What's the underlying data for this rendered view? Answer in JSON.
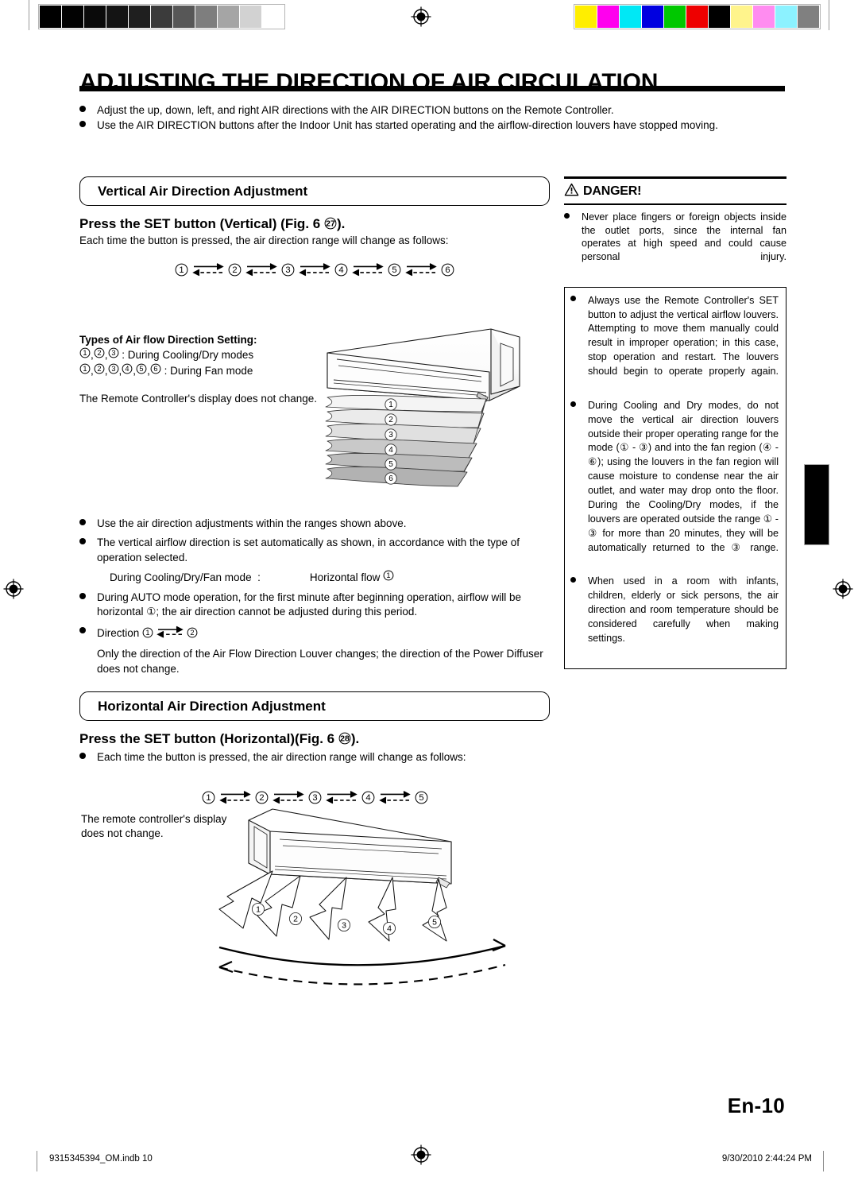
{
  "document": {
    "title": "ADJUSTING THE DIRECTION OF AIR CIRCULATION",
    "page_label": "En-10"
  },
  "intro": {
    "bullets": [
      "Adjust the up, down, left, and right AIR directions with the AIR DIRECTION buttons on the Remote Controller.",
      "Use the AIR DIRECTION buttons after the Indoor Unit has started operating and the airflow-direction louvers have stopped moving."
    ]
  },
  "vertical_section": {
    "heading": "Vertical Air Direction Adjustment",
    "subheading_pre": "Press the SET button (Vertical) (Fig. 6 ",
    "subheading_ref": "27",
    "subheading_post": ").",
    "lead": "Each time the button is pressed, the air direction range will change as follows:",
    "cycle_numbers": [
      "1",
      "2",
      "3",
      "4",
      "5",
      "6"
    ],
    "types_title": "Types of Air flow Direction Setting:",
    "types_rows": [
      {
        "numbers": [
          "1",
          "2",
          "3"
        ],
        "separator": ":",
        "label": "During Cooling/Dry modes"
      },
      {
        "numbers": [
          "1",
          "2",
          "3",
          "4",
          "5",
          "6"
        ],
        "separator": ":",
        "label": "During Fan mode"
      }
    ],
    "remote_note": "The Remote Controller's display does not change.",
    "illustration_labels": [
      "1",
      "2",
      "3",
      "4",
      "5",
      "6"
    ],
    "bullets": [
      "Use the air direction adjustments within the ranges shown above.",
      "The vertical airflow direction is set automatically as shown, in accordance with the type of operation selected.",
      "During AUTO mode operation, for the first minute after beginning operation, airflow will be horizontal ①; the air direction cannot be adjusted during this period."
    ],
    "mode_row": {
      "mode": "During Cooling/Dry/Fan mode",
      "separator": ":",
      "value": "Horizontal flow",
      "value_number": "1"
    },
    "direction_row": {
      "label": "Direction",
      "from": "1",
      "to": "2"
    },
    "direction_note": "Only the direction of the Air Flow Direction Louver changes; the direction of the Power Diffuser does not change."
  },
  "horizontal_section": {
    "heading": "Horizontal Air Direction Adjustment",
    "subheading_pre": "Press the SET button (Horizontal)(Fig. 6 ",
    "subheading_ref": "28",
    "subheading_post": ").",
    "lead": "Each time the button is pressed, the air direction range will change as follows:",
    "cycle_numbers": [
      "1",
      "2",
      "3",
      "4",
      "5"
    ],
    "remote_note": "The remote controller's display does not change.",
    "illustration_labels": [
      "1",
      "2",
      "3",
      "4",
      "5"
    ]
  },
  "danger": {
    "icon": "warning-triangle-icon",
    "title": "DANGER!",
    "first_bullet": "Never place fingers or foreign objects inside the outlet ports, since the internal fan operates at high speed and could cause personal injury.",
    "boxed_bullets": [
      "Always use the Remote Controller's SET button to adjust the vertical airflow louvers. Attempting to move them manually could result in improper operation; in this case, stop operation and restart. The louvers should begin to operate properly again.",
      "During Cooling and Dry modes, do not move the vertical air direction louvers outside their proper operating range for the mode (① - ③) and into the fan region (④ - ⑥); using the louvers in the fan region will cause moisture to condense near the air outlet, and water may drop onto the floor. During the Cooling/Dry modes, if the louvers are operated outside the range ① - ③ for more than 20 minutes, they will be automatically returned to the ③ range.",
      "When used in a room with infants, children, elderly or sick persons, the air direction and room temperature should be considered carefully when making settings."
    ]
  },
  "footer": {
    "left": "9315345394_OM.indb   10",
    "right": "9/30/2010   2:44:24 PM"
  },
  "calibration": {
    "gray_wedge": [
      "#000000",
      "#020202",
      "#0a0a0a",
      "#141414",
      "#1f1f1f",
      "#3b3b3b",
      "#575757",
      "#7e7e7e",
      "#a5a5a5",
      "#d2d2d2",
      "#ffffff"
    ],
    "color_bar": [
      "#ffee00",
      "#ff00ee",
      "#00e8f5",
      "#0000e0",
      "#00c800",
      "#ee0000",
      "#000000",
      "#fff48c",
      "#ff8cf0",
      "#8cf2ff",
      "#808080"
    ]
  }
}
